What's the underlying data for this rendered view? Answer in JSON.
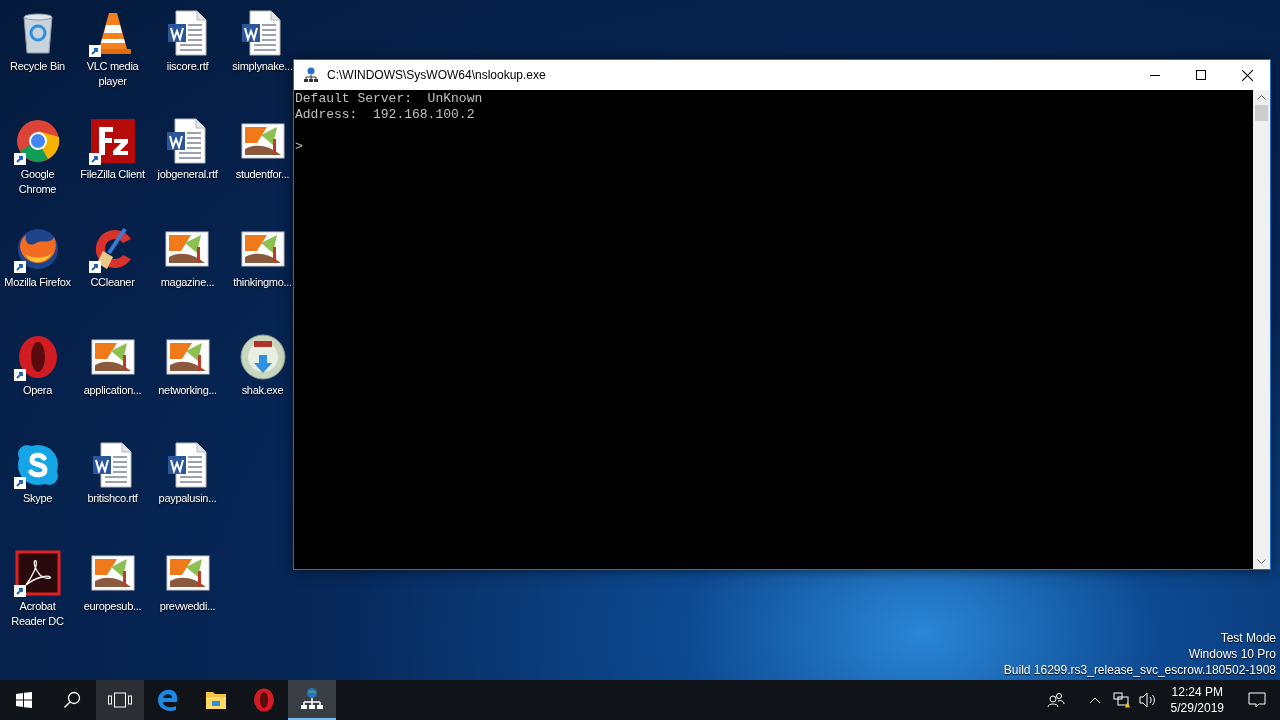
{
  "desktop_icons": [
    {
      "label": "Recycle Bin",
      "kind": "recycle",
      "shortcut": false
    },
    {
      "label": "Google Chrome",
      "kind": "chrome",
      "shortcut": true
    },
    {
      "label": "Mozilla Firefox",
      "kind": "firefox",
      "shortcut": true
    },
    {
      "label": "Opera",
      "kind": "opera",
      "shortcut": true
    },
    {
      "label": "Skype",
      "kind": "skype",
      "shortcut": true
    },
    {
      "label": "Acrobat Reader DC",
      "kind": "acrobat",
      "shortcut": true
    },
    {
      "label": "VLC media player",
      "kind": "vlc",
      "shortcut": true
    },
    {
      "label": "FileZilla Client",
      "kind": "filezilla",
      "shortcut": true
    },
    {
      "label": "CCleaner",
      "kind": "ccleaner",
      "shortcut": true
    },
    {
      "label": "application...",
      "kind": "image",
      "shortcut": false
    },
    {
      "label": "britishco.rtf",
      "kind": "word",
      "shortcut": false
    },
    {
      "label": "europesub...",
      "kind": "image",
      "shortcut": false
    },
    {
      "label": "iiscore.rtf",
      "kind": "word",
      "shortcut": false
    },
    {
      "label": "jobgeneral.rtf",
      "kind": "word",
      "shortcut": false
    },
    {
      "label": "magazine...",
      "kind": "image",
      "shortcut": false
    },
    {
      "label": "networking...",
      "kind": "image",
      "shortcut": false
    },
    {
      "label": "paypalusin...",
      "kind": "word",
      "shortcut": false
    },
    {
      "label": "prevweddi...",
      "kind": "image",
      "shortcut": false
    },
    {
      "label": "simplynake...",
      "kind": "word",
      "shortcut": false
    },
    {
      "label": "studentfor...",
      "kind": "image",
      "shortcut": false
    },
    {
      "label": "thinkingmo...",
      "kind": "image",
      "shortcut": false
    },
    {
      "label": "shak.exe",
      "kind": "setup",
      "shortcut": false
    }
  ],
  "console_window": {
    "title": "C:\\WINDOWS\\SysWOW64\\nslookup.exe",
    "lines": [
      "Default Server:  UnKnown",
      "Address:  192.168.100.2"
    ],
    "prompt": ">"
  },
  "watermark_text": [
    "Test Mode",
    "Windows 10 Pro",
    "Build 16299.rs3_release_svc_escrow.180502-1908"
  ],
  "taskbar": {
    "items": [
      {
        "kind": "start",
        "active": false,
        "highlighted": false
      },
      {
        "kind": "search",
        "active": false,
        "highlighted": false
      },
      {
        "kind": "taskview",
        "active": false,
        "highlighted": true
      },
      {
        "kind": "edge",
        "active": false,
        "highlighted": false
      },
      {
        "kind": "explorer",
        "active": false,
        "highlighted": false
      },
      {
        "kind": "opera",
        "active": false,
        "highlighted": false
      },
      {
        "kind": "nslookup",
        "active": true,
        "highlighted": false
      }
    ],
    "time": "12:24 PM",
    "date": "5/29/2019"
  }
}
